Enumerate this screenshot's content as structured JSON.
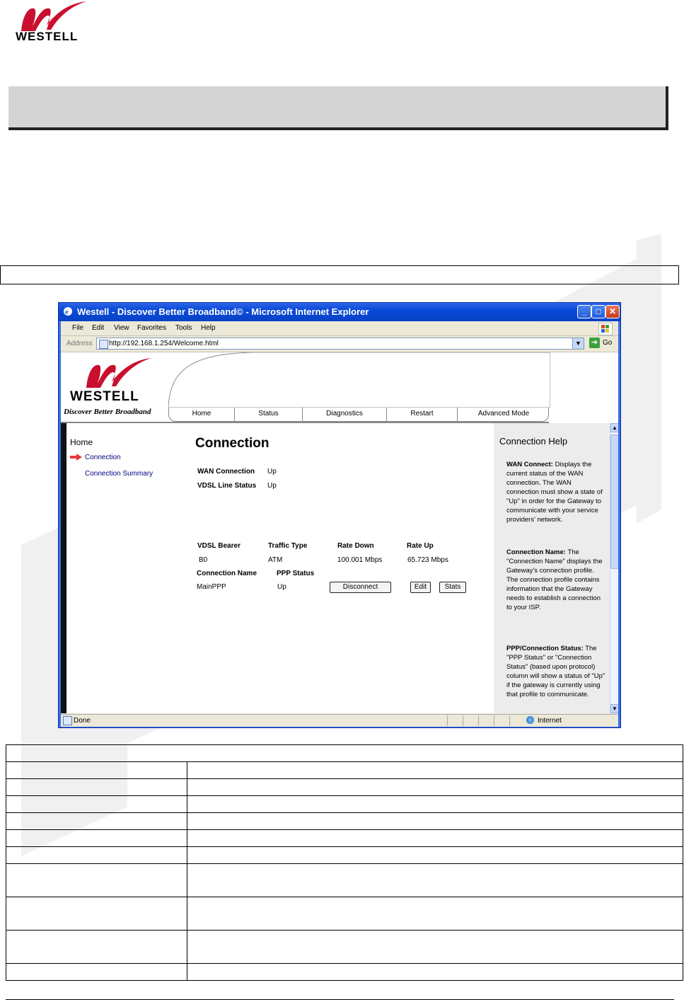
{
  "doc": {
    "logo_text": "WESTELL"
  },
  "browser": {
    "window_title": "Westell - Discover Better Broadband© - Microsoft Internet Explorer",
    "menu": [
      "File",
      "Edit",
      "View",
      "Favorites",
      "Tools",
      "Help"
    ],
    "address_label": "Address",
    "url": "http://192.168.1.254/Welcome.html",
    "go_label": "Go",
    "status_text": "Done",
    "zone_text": "Internet"
  },
  "site": {
    "logo_text": "WESTELL",
    "tagline": "Discover Better Broadband",
    "nav": [
      "Home",
      "Status",
      "Diagnostics",
      "Restart",
      "Advanced Mode"
    ]
  },
  "sidebar": {
    "home": "Home",
    "items": [
      "Connection",
      "Connection Summary"
    ]
  },
  "main": {
    "title": "Connection",
    "wan_label": "WAN Connection",
    "wan_value": "Up",
    "vdsl_label": "VDSL Line Status",
    "vdsl_value": "Up",
    "headers": [
      "VDSL Bearer",
      "Traffic Type",
      "Rate Down",
      "Rate Up"
    ],
    "row": [
      "B0",
      "ATM",
      "100.001 Mbps",
      "65.723 Mbps"
    ],
    "conn_headers": [
      "Connection Name",
      "PPP Status"
    ],
    "conn_row": [
      "MainPPP",
      "Up"
    ],
    "buttons": {
      "disconnect": "Disconnect",
      "edit": "Edit",
      "stats": "Stats"
    }
  },
  "help": {
    "title": "Connection Help",
    "sections": [
      {
        "heading": "WAN Connect:",
        "text": " Displays the current status of the WAN connection. The WAN connection must show a state of \"Up\" in order for the Gateway to communicate with your service providers' network."
      },
      {
        "heading": "Connection Name:",
        "text": " The \"Connection Name\" displays the Gateway's connection profile. The connection profile contains information that the Gateway needs to establish a connection to your ISP."
      },
      {
        "heading": "PPP/Connection Status:",
        "text": " The \"PPP Status\" or \"Connection Status\" (based upon protocol) column will show a status of \"Up\" if the gateway is currently using that profile to communicate."
      }
    ]
  }
}
